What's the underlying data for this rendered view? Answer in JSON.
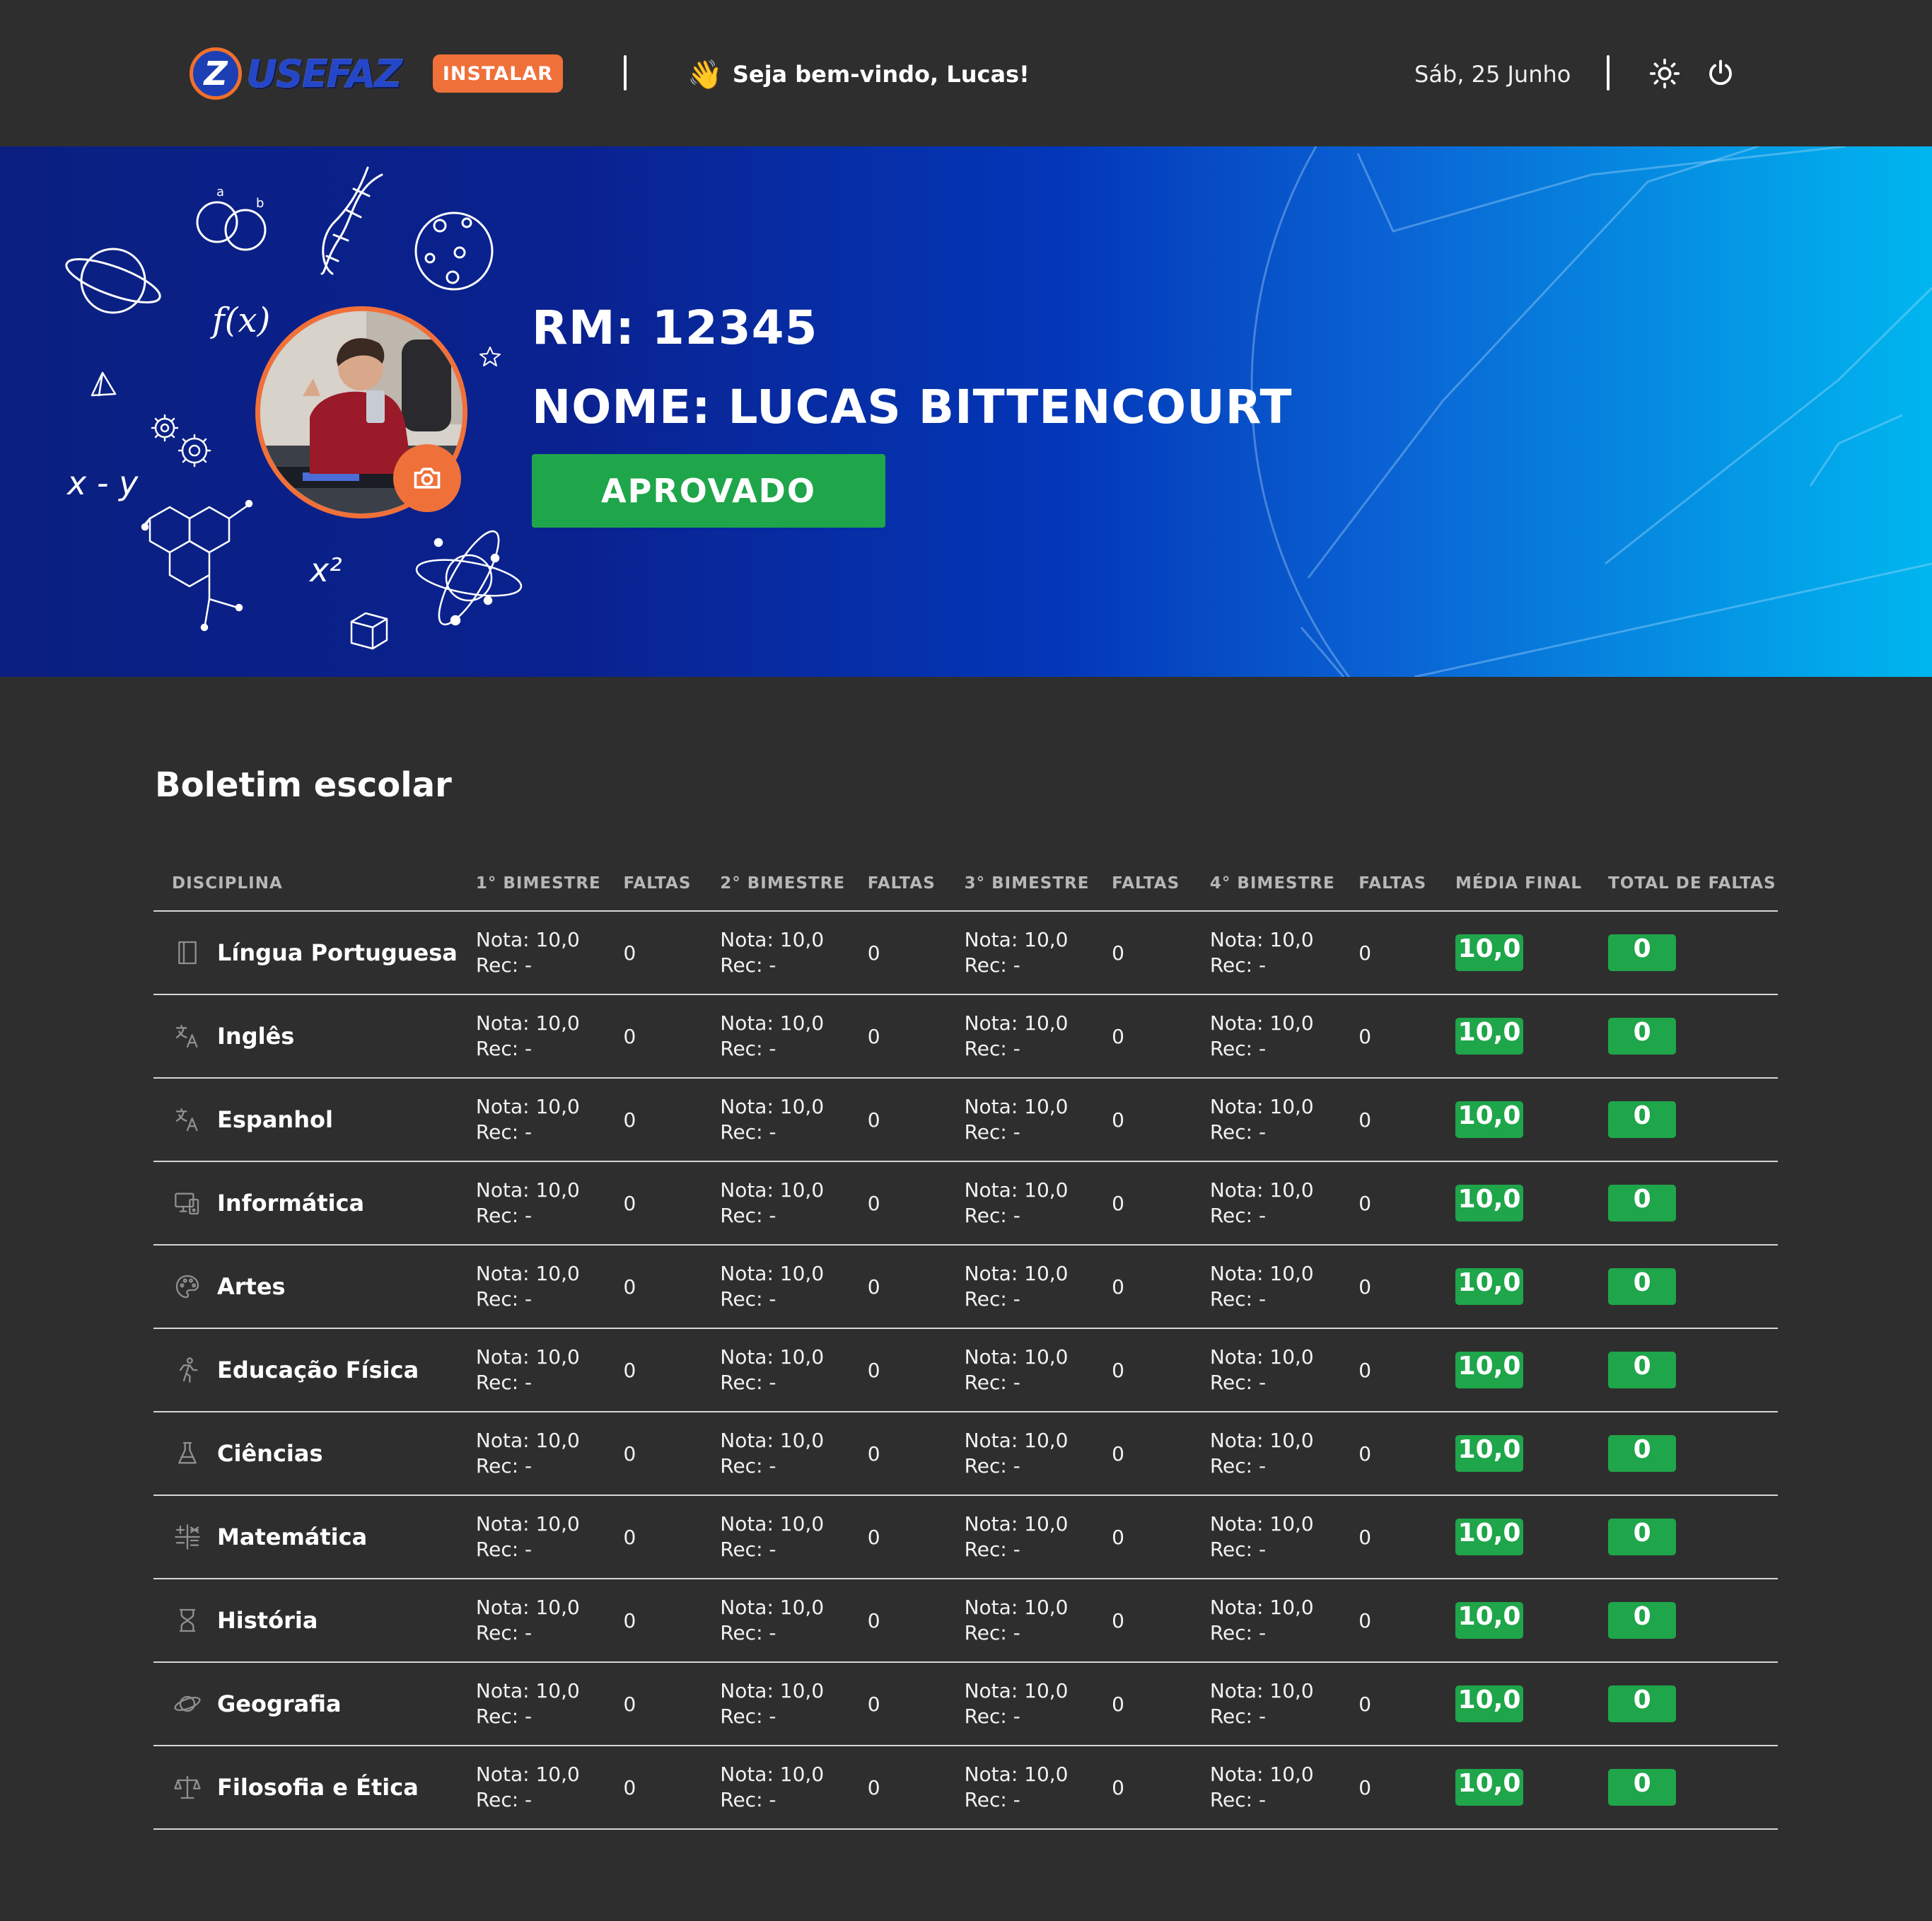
{
  "header": {
    "logo_text": "USEFAZ",
    "install_label": "INSTALAR",
    "welcome_emoji": "👋",
    "welcome": "Seja bem-vindo, Lucas!",
    "date": "Sáb, 25 Junho",
    "theme_icon": "sun-icon",
    "power_icon": "power-icon"
  },
  "profile": {
    "rm": "RM: 12345",
    "nome": "NOME: LUCAS BITTENCOURT",
    "status": "APROVADO",
    "status_color": "#1fa54a",
    "accent_color": "#f0703a"
  },
  "report": {
    "title": "Boletim escolar",
    "columns": [
      "DISCIPLINA",
      "1° BIMESTRE",
      "FALTAS",
      "2° BIMESTRE",
      "FALTAS",
      "3° BIMESTRE",
      "FALTAS",
      "4° BIMESTRE",
      "FALTAS",
      "MÉDIA FINAL",
      "TOTAL DE FALTAS"
    ],
    "rows": [
      {
        "disciplina": "Língua Portuguesa",
        "icon": "book-icon",
        "bimestres": [
          {
            "nota": "Nota: 10,0",
            "rec": "Rec: -",
            "faltas": "0"
          },
          {
            "nota": "Nota: 10,0",
            "rec": "Rec: -",
            "faltas": "0"
          },
          {
            "nota": "Nota: 10,0",
            "rec": "Rec: -",
            "faltas": "0"
          },
          {
            "nota": "Nota: 10,0",
            "rec": "Rec: -",
            "faltas": "0"
          }
        ],
        "media": "10,0",
        "total_faltas": "0"
      },
      {
        "disciplina": "Inglês",
        "icon": "translate-icon",
        "bimestres": [
          {
            "nota": "Nota: 10,0",
            "rec": "Rec: -",
            "faltas": "0"
          },
          {
            "nota": "Nota: 10,0",
            "rec": "Rec: -",
            "faltas": "0"
          },
          {
            "nota": "Nota: 10,0",
            "rec": "Rec: -",
            "faltas": "0"
          },
          {
            "nota": "Nota: 10,0",
            "rec": "Rec: -",
            "faltas": "0"
          }
        ],
        "media": "10,0",
        "total_faltas": "0"
      },
      {
        "disciplina": "Espanhol",
        "icon": "translate-icon",
        "bimestres": [
          {
            "nota": "Nota: 10,0",
            "rec": "Rec: -",
            "faltas": "0"
          },
          {
            "nota": "Nota: 10,0",
            "rec": "Rec: -",
            "faltas": "0"
          },
          {
            "nota": "Nota: 10,0",
            "rec": "Rec: -",
            "faltas": "0"
          },
          {
            "nota": "Nota: 10,0",
            "rec": "Rec: -",
            "faltas": "0"
          }
        ],
        "media": "10,0",
        "total_faltas": "0"
      },
      {
        "disciplina": "Informática",
        "icon": "devices-icon",
        "bimestres": [
          {
            "nota": "Nota: 10,0",
            "rec": "Rec: -",
            "faltas": "0"
          },
          {
            "nota": "Nota: 10,0",
            "rec": "Rec: -",
            "faltas": "0"
          },
          {
            "nota": "Nota: 10,0",
            "rec": "Rec: -",
            "faltas": "0"
          },
          {
            "nota": "Nota: 10,0",
            "rec": "Rec: -",
            "faltas": "0"
          }
        ],
        "media": "10,0",
        "total_faltas": "0"
      },
      {
        "disciplina": "Artes",
        "icon": "palette-icon",
        "bimestres": [
          {
            "nota": "Nota: 10,0",
            "rec": "Rec: -",
            "faltas": "0"
          },
          {
            "nota": "Nota: 10,0",
            "rec": "Rec: -",
            "faltas": "0"
          },
          {
            "nota": "Nota: 10,0",
            "rec": "Rec: -",
            "faltas": "0"
          },
          {
            "nota": "Nota: 10,0",
            "rec": "Rec: -",
            "faltas": "0"
          }
        ],
        "media": "10,0",
        "total_faltas": "0"
      },
      {
        "disciplina": "Educação Física",
        "icon": "running-icon",
        "bimestres": [
          {
            "nota": "Nota: 10,0",
            "rec": "Rec: -",
            "faltas": "0"
          },
          {
            "nota": "Nota: 10,0",
            "rec": "Rec: -",
            "faltas": "0"
          },
          {
            "nota": "Nota: 10,0",
            "rec": "Rec: -",
            "faltas": "0"
          },
          {
            "nota": "Nota: 10,0",
            "rec": "Rec: -",
            "faltas": "0"
          }
        ],
        "media": "10,0",
        "total_faltas": "0"
      },
      {
        "disciplina": "Ciências",
        "icon": "flask-icon",
        "bimestres": [
          {
            "nota": "Nota: 10,0",
            "rec": "Rec: -",
            "faltas": "0"
          },
          {
            "nota": "Nota: 10,0",
            "rec": "Rec: -",
            "faltas": "0"
          },
          {
            "nota": "Nota: 10,0",
            "rec": "Rec: -",
            "faltas": "0"
          },
          {
            "nota": "Nota: 10,0",
            "rec": "Rec: -",
            "faltas": "0"
          }
        ],
        "media": "10,0",
        "total_faltas": "0"
      },
      {
        "disciplina": "Matemática",
        "icon": "calculator-icon",
        "bimestres": [
          {
            "nota": "Nota: 10,0",
            "rec": "Rec: -",
            "faltas": "0"
          },
          {
            "nota": "Nota: 10,0",
            "rec": "Rec: -",
            "faltas": "0"
          },
          {
            "nota": "Nota: 10,0",
            "rec": "Rec: -",
            "faltas": "0"
          },
          {
            "nota": "Nota: 10,0",
            "rec": "Rec: -",
            "faltas": "0"
          }
        ],
        "media": "10,0",
        "total_faltas": "0"
      },
      {
        "disciplina": "História",
        "icon": "hourglass-icon",
        "bimestres": [
          {
            "nota": "Nota: 10,0",
            "rec": "Rec: -",
            "faltas": "0"
          },
          {
            "nota": "Nota: 10,0",
            "rec": "Rec: -",
            "faltas": "0"
          },
          {
            "nota": "Nota: 10,0",
            "rec": "Rec: -",
            "faltas": "0"
          },
          {
            "nota": "Nota: 10,0",
            "rec": "Rec: -",
            "faltas": "0"
          }
        ],
        "media": "10,0",
        "total_faltas": "0"
      },
      {
        "disciplina": "Geografia",
        "icon": "planet-icon",
        "bimestres": [
          {
            "nota": "Nota: 10,0",
            "rec": "Rec: -",
            "faltas": "0"
          },
          {
            "nota": "Nota: 10,0",
            "rec": "Rec: -",
            "faltas": "0"
          },
          {
            "nota": "Nota: 10,0",
            "rec": "Rec: -",
            "faltas": "0"
          },
          {
            "nota": "Nota: 10,0",
            "rec": "Rec: -",
            "faltas": "0"
          }
        ],
        "media": "10,0",
        "total_faltas": "0"
      },
      {
        "disciplina": "Filosofia e Ética",
        "icon": "scale-icon",
        "bimestres": [
          {
            "nota": "Nota: 10,0",
            "rec": "Rec: -",
            "faltas": "0"
          },
          {
            "nota": "Nota: 10,0",
            "rec": "Rec: -",
            "faltas": "0"
          },
          {
            "nota": "Nota: 10,0",
            "rec": "Rec: -",
            "faltas": "0"
          },
          {
            "nota": "Nota: 10,0",
            "rec": "Rec: -",
            "faltas": "0"
          }
        ],
        "media": "10,0",
        "total_faltas": "0"
      }
    ]
  }
}
